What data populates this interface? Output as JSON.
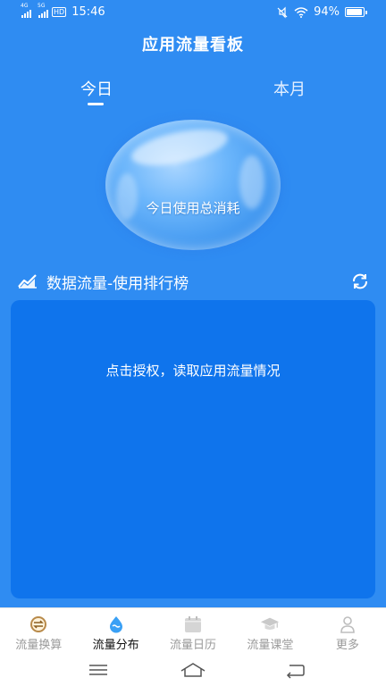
{
  "status_bar": {
    "signal1_tag": "4G",
    "signal2_tag": "5G",
    "hd": "HD",
    "time": "15:46",
    "battery": "94%"
  },
  "app_title": "应用流量看板",
  "tabs": {
    "today": "今日",
    "month": "本月",
    "active": "today"
  },
  "bubble": {
    "label": "今日使用总消耗"
  },
  "ranking": {
    "title": "数据流量-使用排行榜",
    "auth_prompt": "点击授权，读取应用流量情况"
  },
  "bottom_nav": {
    "items": [
      {
        "label": "流量换算",
        "icon": "exchange-icon"
      },
      {
        "label": "流量分布",
        "icon": "water-drop-icon"
      },
      {
        "label": "流量日历",
        "icon": "calendar-icon"
      },
      {
        "label": "流量课堂",
        "icon": "graduation-cap-icon"
      },
      {
        "label": "更多",
        "icon": "user-icon"
      }
    ],
    "active_index": 1
  },
  "colors": {
    "primary_bg": "#2f8cf2",
    "panel_bg": "#0f74ec",
    "nav_active": "#111111",
    "nav_inactive": "#9a9a9a"
  }
}
